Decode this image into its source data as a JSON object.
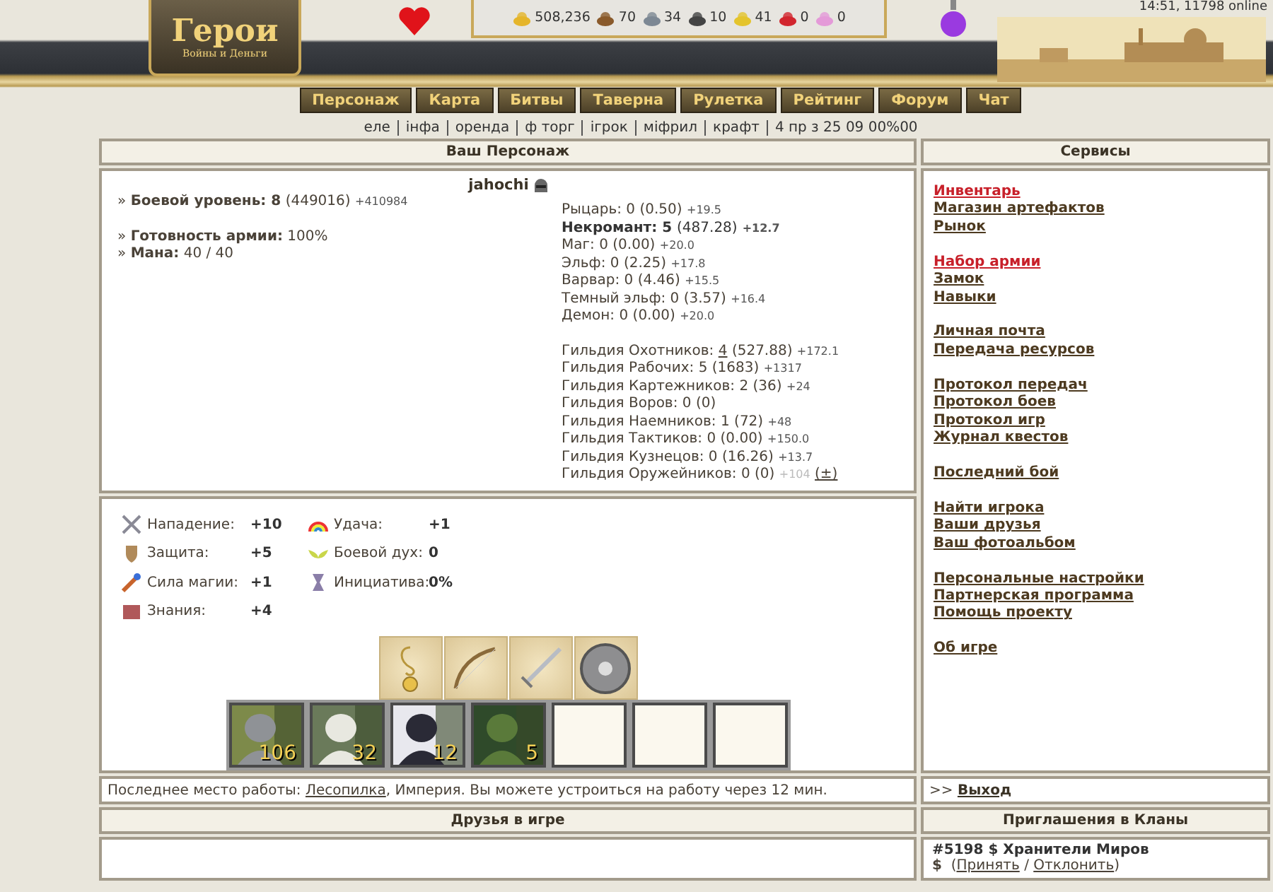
{
  "header": {
    "logo_title": "Герои",
    "logo_subtitle": "Войны и Деньги",
    "server_status": "14:51, 11798 online",
    "resources": [
      "508,236",
      "70",
      "34",
      "10",
      "41",
      "0",
      "0"
    ],
    "nav": [
      "Персонаж",
      "Карта",
      "Битвы",
      "Таверна",
      "Рулетка",
      "Рейтинг",
      "Форум",
      "Чат"
    ],
    "subnav": [
      "еле",
      "інфа",
      "оренда",
      "ф торг",
      "ігрок",
      "міфрил",
      "крафт",
      "4 пр з 25 09 00%00"
    ]
  },
  "character": {
    "title": "Ваш Персонаж",
    "name": "jahochi",
    "info_groups": [
      [
        {
          "bullet": "»",
          "label": "Боевой уровень:",
          "value_bold": "8",
          "value": "(449016)",
          "delta": "+410984"
        }
      ],
      [
        {
          "bullet": "»",
          "label": "Готовность армии:",
          "value": "100%"
        },
        {
          "bullet": "»",
          "label": "Мана:",
          "value": "40 / 40"
        }
      ]
    ],
    "factions": [
      {
        "label": "Рыцарь:",
        "level": "0",
        "score": "(0.50)",
        "delta": "+19.5",
        "current": false
      },
      {
        "label": "Некромант:",
        "level": "5",
        "score": "(487.28)",
        "delta": "+12.7",
        "current": true
      },
      {
        "label": "Маг:",
        "level": "0",
        "score": "(0.00)",
        "delta": "+20.0",
        "current": false
      },
      {
        "label": "Эльф:",
        "level": "0",
        "score": "(2.25)",
        "delta": "+17.8",
        "current": false
      },
      {
        "label": "Варвар:",
        "level": "0",
        "score": "(4.46)",
        "delta": "+15.5",
        "current": false
      },
      {
        "label": "Темный эльф:",
        "level": "0",
        "score": "(3.57)",
        "delta": "+16.4",
        "current": false
      },
      {
        "label": "Демон:",
        "level": "0",
        "score": "(0.00)",
        "delta": "+20.0",
        "current": false
      }
    ],
    "guilds": [
      {
        "label": "Гильдия Охотников:",
        "level": "4",
        "score": "(527.88)",
        "delta": "+172.1",
        "linked": true
      },
      {
        "label": "Гильдия Рабочих:",
        "level": "5",
        "score": "(1683)",
        "delta": "+1317",
        "linked": false
      },
      {
        "label": "Гильдия Картежников:",
        "level": "2",
        "score": "(36)",
        "delta": "+24",
        "linked": false
      },
      {
        "label": "Гильдия Воров:",
        "level": "0",
        "score": "(0)",
        "linked": false
      },
      {
        "label": "Гильдия Наемников:",
        "level": "1",
        "score": "(72)",
        "delta": "+48",
        "linked": false
      },
      {
        "label": "Гильдия Тактиков:",
        "level": "0",
        "score": "(0.00)",
        "delta": "+150.0",
        "linked": false
      },
      {
        "label": "Гильдия Кузнецов:",
        "level": "0",
        "score": "(16.26)",
        "delta": "+13.7",
        "linked": false
      },
      {
        "label": "Гильдия Оружейников:",
        "level": "0",
        "score": "(0)",
        "delta": "+104",
        "linked": false,
        "action": "(±)"
      }
    ]
  },
  "stats": [
    {
      "label": "Нападение:",
      "value": "+10"
    },
    {
      "label": "Защита:",
      "value": "+5"
    },
    {
      "label": "Сила магии:",
      "value": "+1"
    },
    {
      "label": "Знания:",
      "value": "+4"
    },
    {
      "label": "Удача:",
      "value": "+1"
    },
    {
      "label": "Боевой дух:",
      "value": "0"
    },
    {
      "label": "Инициатива:",
      "value": "0%"
    }
  ],
  "artifacts": [
    {
      "kind": "amulet"
    },
    {
      "kind": "bow"
    },
    {
      "kind": "sword"
    },
    {
      "kind": "shield"
    }
  ],
  "army": [
    {
      "kind": "picture",
      "count": "106"
    },
    {
      "kind": "picture",
      "count": "32"
    },
    {
      "kind": "picture",
      "count": "12"
    },
    {
      "kind": "picture",
      "count": "5"
    },
    {
      "kind": "empty"
    },
    {
      "kind": "empty"
    },
    {
      "kind": "empty"
    }
  ],
  "work": {
    "prefix": "Последнее место работы: ",
    "link": "Лесопилка",
    "suffix": ", Империя. Вы можете устроиться на работу через 12 мин."
  },
  "services": {
    "title": "Сервисы",
    "groups": [
      [
        {
          "label": "Инвентарь",
          "highlighted": true
        },
        {
          "label": "Магазин артефактов",
          "highlighted": false
        },
        {
          "label": "Рынок",
          "highlighted": false
        }
      ],
      [
        {
          "label": "Набор армии",
          "highlighted": true
        },
        {
          "label": "Замок",
          "highlighted": false
        },
        {
          "label": "Навыки",
          "highlighted": false
        }
      ],
      [
        {
          "label": "Личная почта",
          "highlighted": false
        },
        {
          "label": "Передача ресурсов",
          "highlighted": false
        }
      ],
      [
        {
          "label": "Протокол передач",
          "highlighted": false
        },
        {
          "label": "Протокол боев",
          "highlighted": false
        },
        {
          "label": "Протокол игр",
          "highlighted": false
        },
        {
          "label": "Журнал квестов",
          "highlighted": false
        }
      ],
      [
        {
          "label": "Последний бой",
          "highlighted": false
        }
      ],
      [
        {
          "label": "Найти игрока",
          "highlighted": false
        },
        {
          "label": "Ваши друзья",
          "highlighted": false
        },
        {
          "label": "Ваш фотоальбом",
          "highlighted": false
        }
      ],
      [
        {
          "label": "Персональные настройки",
          "highlighted": false
        },
        {
          "label": "Партнерская программа",
          "highlighted": false
        },
        {
          "label": "Помощь проекту",
          "highlighted": false
        }
      ],
      [
        {
          "label": "Об игре",
          "highlighted": false
        }
      ]
    ]
  },
  "exit": {
    "prefix": ">>",
    "link": "Выход"
  },
  "friends": {
    "title": "Друзья в игре"
  },
  "clans": {
    "title": "Приглашения в Кланы",
    "invite": "#5198 $ Хранители Миров",
    "symbol": "$",
    "open": "(",
    "accept": "Принять",
    "separator": "/",
    "decline": "Отклонить",
    "close": ")"
  }
}
